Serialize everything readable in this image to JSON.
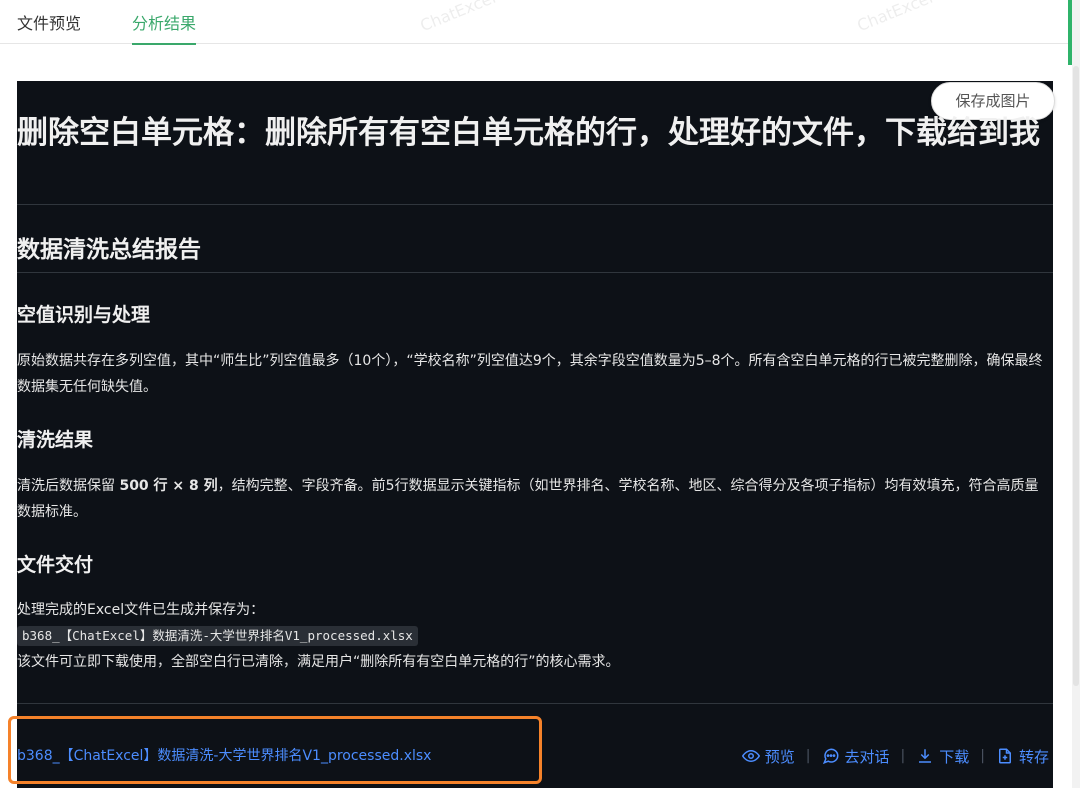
{
  "tabs": [
    {
      "label": "文件预览"
    },
    {
      "label": "分析结果"
    }
  ],
  "watermark_text": "ChatExcel",
  "save_image_button": "保存成图片",
  "report": {
    "title": "删除空白单元格：删除所有有空白单元格的行，处理好的文件，下载给到我",
    "summary_heading": "数据清洗总结报告",
    "sections": [
      {
        "heading": "空值识别与处理",
        "paragraph": "原始数据共存在多列空值，其中“师生比”列空值最多（10个），“学校名称”列空值达9个，其余字段空值数量为5–8个。所有含空白单元格的行已被完整删除，确保最终数据集无任何缺失值。"
      },
      {
        "heading": "清洗结果",
        "paragraph_pre": "清洗后数据保留 ",
        "rows_bold": "500 行 × 8 列",
        "paragraph_post": "，结构完整、字段齐备。前5行数据显示关键指标（如世界排名、学校名称、地区、综合得分及各项子指标）均有效填充，符合高质量数据标准。"
      },
      {
        "heading": "文件交付",
        "intro": "处理完成的Excel文件已生成并保存为：",
        "filename_code": "b368_【ChatExcel】数据清洗-大学世界排名V1_processed.xlsx",
        "outro": "该文件可立即下载使用，全部空白行已清除，满足用户“删除所有有空白单元格的行”的核心需求。"
      }
    ]
  },
  "footer": {
    "file_link": "b368_【ChatExcel】数据清洗-大学世界排名V1_processed.xlsx",
    "actions": {
      "preview": "预览",
      "chat": "去对话",
      "download": "下载",
      "save": "转存"
    }
  },
  "colors": {
    "accent_green": "#3aa86b",
    "panel_bg": "#0d1117",
    "link_blue": "#4c8dff",
    "highlight_orange": "#f5822a"
  }
}
